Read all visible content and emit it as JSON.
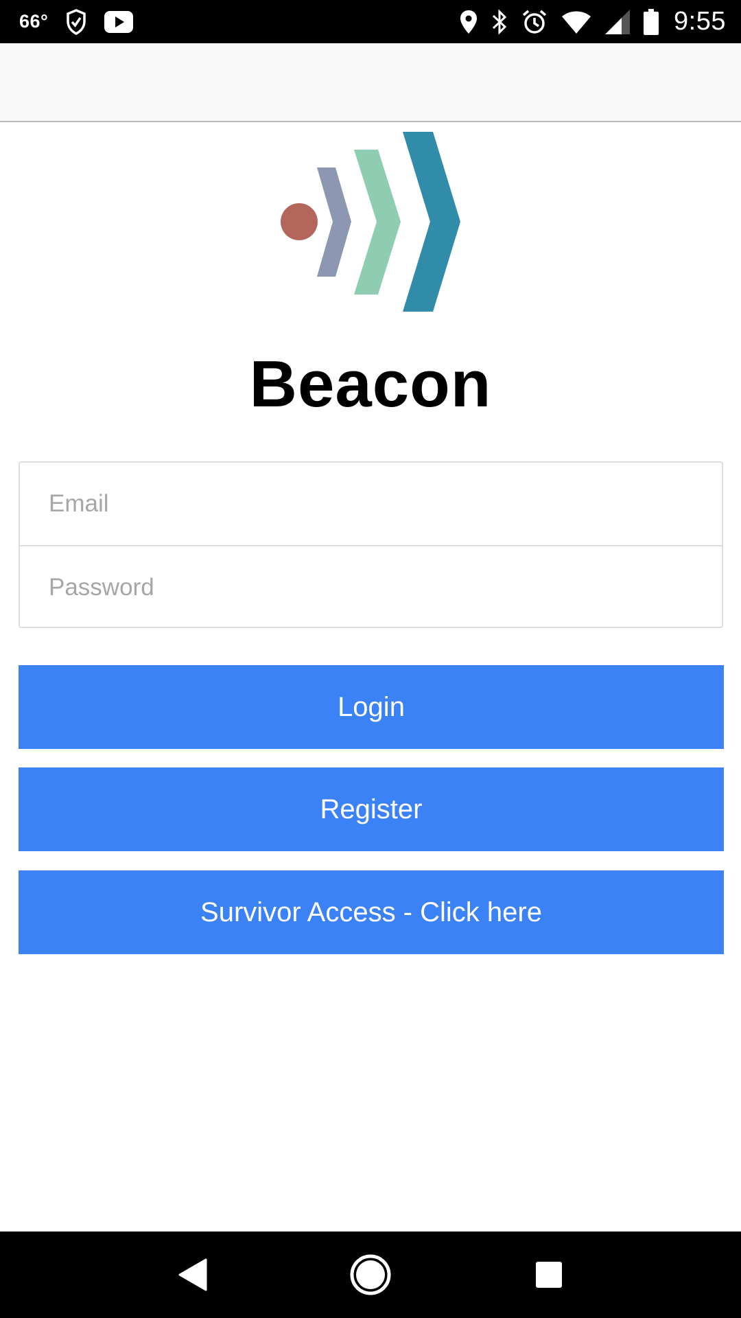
{
  "status_bar": {
    "temperature": "66°",
    "time": "9:55",
    "left_icons": [
      "shield-check-icon",
      "youtube-icon"
    ],
    "right_icons": [
      "location-icon",
      "bluetooth-icon",
      "alarm-icon",
      "wifi-icon",
      "signal-icon",
      "battery-icon"
    ]
  },
  "app": {
    "title": "Beacon",
    "logo": {
      "dot_color": "#b5665c",
      "chevron_colors": [
        "#8e97b1",
        "#8ecdb1",
        "#308ca8"
      ]
    }
  },
  "form": {
    "email_placeholder": "Email",
    "password_placeholder": "Password"
  },
  "buttons": {
    "login": "Login",
    "register": "Register",
    "survivor_access": "Survivor Access - Click here"
  },
  "colors": {
    "button_bg": "#3b82f6",
    "app_bar_bg": "#f8f8f8"
  },
  "nav_bar": {
    "icons": [
      "back-icon",
      "home-icon",
      "recents-icon"
    ]
  }
}
